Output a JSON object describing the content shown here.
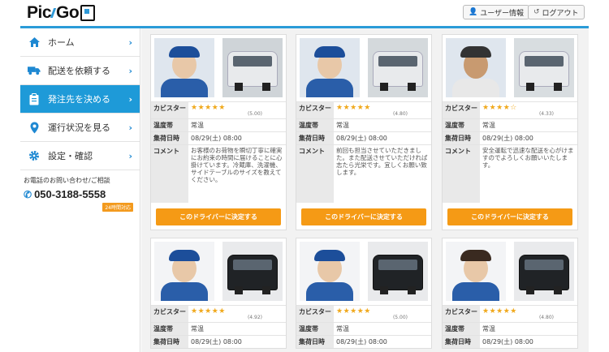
{
  "header": {
    "logo_text": "Pic",
    "logo_text2": "Go",
    "user_info": "ユーザー情報",
    "logout": "ログアウト"
  },
  "sidebar": {
    "items": [
      {
        "label": "ホーム",
        "icon": "home-icon"
      },
      {
        "label": "配送を依頼する",
        "icon": "truck-icon"
      },
      {
        "label": "発注先を決める",
        "icon": "clipboard-icon"
      },
      {
        "label": "運行状況を見る",
        "icon": "location-pin-icon"
      },
      {
        "label": "設定・確認",
        "icon": "gear-icon"
      }
    ],
    "contact_label": "お電話のお問い合わせ/ご相談",
    "phone": "050-3188-5558",
    "badge": "24時間対応"
  },
  "labels": {
    "rating": "カビスター",
    "temp": "温度帯",
    "datetime": "集荷日時",
    "comment": "コメント",
    "decide": "このドライバーに決定する"
  },
  "drivers": [
    {
      "stars": "★★★★★",
      "score": "(5.00)",
      "temp": "常温",
      "datetime": "08/29(土) 08:00",
      "comment": "お客様のお荷物を瞬切丁寧に確実にお約束の時間に届けることに心掛けています。冷蔵庫、洗濯機、サイドテーブルのサイズを教えてください。"
    },
    {
      "stars": "★★★★★",
      "score": "(4.80)",
      "temp": "常温",
      "datetime": "08/29(土) 08:00",
      "comment": "前回も担当させていただきました。また配送させていただければ志たら光栄です。宜しくお願い致します。"
    },
    {
      "stars": "★★★★☆",
      "score": "(4.33)",
      "temp": "常温",
      "datetime": "08/29(土) 08:00",
      "comment": "安全運転で迅速な配送を心がけますのでよろしくお願いいたします。"
    },
    {
      "stars": "★★★★★",
      "score": "(4.92)",
      "temp": "常温",
      "datetime": "08/29(土) 08:00",
      "comment": ""
    },
    {
      "stars": "★★★★★",
      "score": "(5.00)",
      "temp": "常温",
      "datetime": "08/29(土) 08:00",
      "comment": ""
    },
    {
      "stars": "★★★★★",
      "score": "(4.80)",
      "temp": "常温",
      "datetime": "08/29(土) 08:00",
      "comment": ""
    }
  ]
}
